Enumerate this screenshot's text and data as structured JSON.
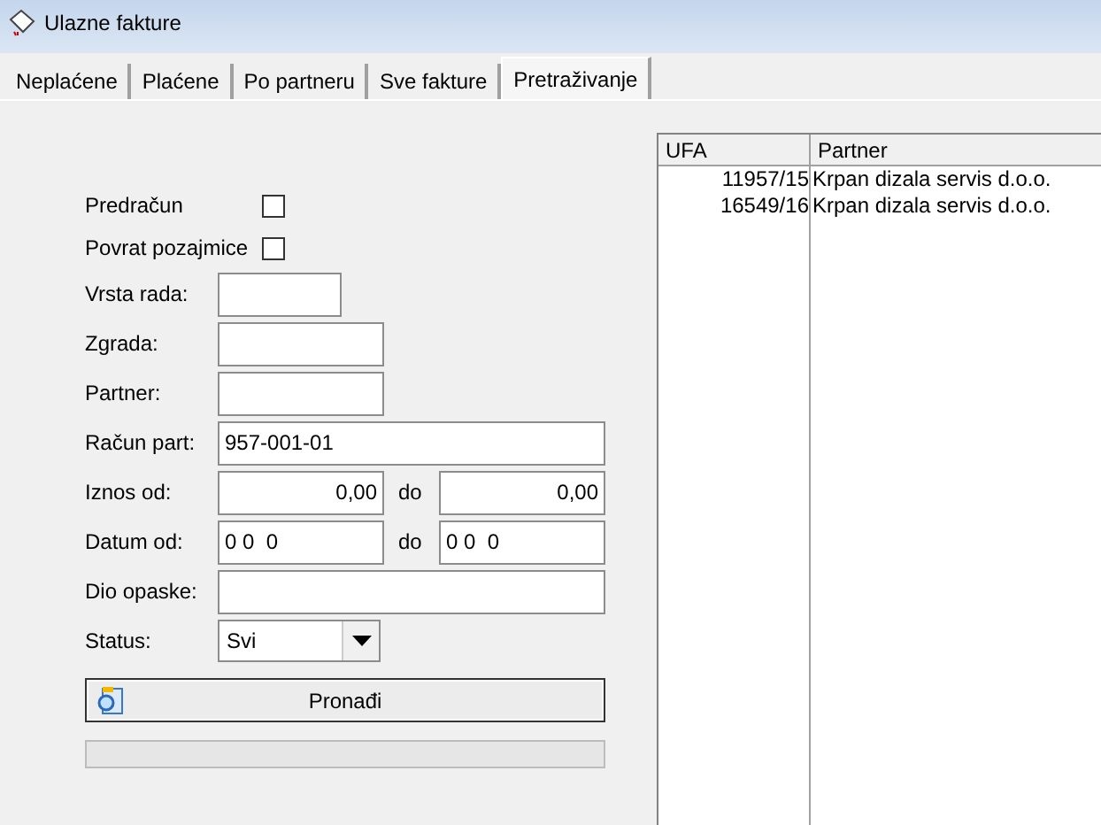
{
  "window": {
    "title": "Ulazne fakture"
  },
  "tabs": [
    {
      "label": "Neplaćene",
      "selected": false
    },
    {
      "label": "Plaćene",
      "selected": false
    },
    {
      "label": "Po partneru",
      "selected": false
    },
    {
      "label": "Sve fakture",
      "selected": false
    },
    {
      "label": "Pretraživanje",
      "selected": true
    }
  ],
  "form": [
    {
      "kind": "checkbox",
      "label": "Predračun",
      "checked": false
    },
    {
      "kind": "checkbox",
      "label": "Povrat pozajmice",
      "checked": false
    },
    {
      "kind": "short",
      "label": "Vrsta rada:"
    },
    {
      "kind": "medium",
      "label": "Zgrada:"
    },
    {
      "kind": "medium",
      "label": "Partner:"
    },
    {
      "kind": "wide",
      "label": "Račun part:",
      "value": "957-001-01"
    },
    {
      "kind": "amount",
      "label": "Iznos od:",
      "value": "0,00",
      "to_label": "do",
      "to_value": "0,00"
    },
    {
      "kind": "date",
      "label": "Datum od:",
      "value": "0 0  0",
      "to_label": "do",
      "to_value": "0 0  0"
    },
    {
      "kind": "wide",
      "label": "Dio opaske:"
    },
    {
      "kind": "select",
      "label": "Status:",
      "value": "Svi"
    }
  ],
  "search_button": {
    "label": "Pronađi"
  },
  "progress": {
    "level": 0
  },
  "results": {
    "columns": [
      "UFA",
      "Partner"
    ],
    "rows": [
      [
        "11957/15",
        "Krpan dizala servis d.o.o."
      ],
      [
        "16549/16",
        "Krpan dizala servis d.o.o."
      ]
    ]
  }
}
